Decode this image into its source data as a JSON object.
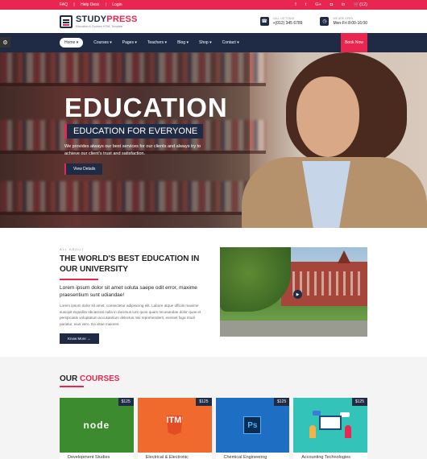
{
  "topbar": {
    "links": [
      "FAQ",
      "Help Desk",
      "Login"
    ],
    "social_icons": [
      "facebook-icon",
      "twitter-icon",
      "google-plus-icon",
      "instagram-icon",
      "linkedin-icon"
    ],
    "social_glyphs": [
      "f",
      "t",
      "G+",
      "◘",
      "in"
    ],
    "cart": "(12)"
  },
  "header": {
    "brand_part1": "STUDY",
    "brand_part2": "PRESS",
    "tagline": "Education & Courses HTML Template",
    "call_label": "CALL US TODAY",
    "call_value": "+(012) 345 6789",
    "open_label": "WE ARE OPEN",
    "open_value": "Mon-Fri 8:00-16:00"
  },
  "nav": {
    "items": [
      "Home",
      "Courses",
      "Pages",
      "Teachers",
      "Blog",
      "Shop",
      "Contact"
    ],
    "book_now": "Book Now"
  },
  "hero": {
    "title": "EDUCATION",
    "subtitle": "EDUCATION FOR EVERYONE",
    "description": "We provides always our best services for our clients and always try to achieve our client's trust and satisfaction.",
    "button": "View Details"
  },
  "about": {
    "label": "ALL ABOUT",
    "title": "THE WORLD'S BEST EDUCATION IN OUR UNIVERSITY",
    "lead": "Lorem ipsum dolor sit amet soluta saepe odit error, maxime praesentium sunt udiandae!",
    "body": "Lorem ipsum dolor sit amet, consectetur adipisicing elit. Labore atque officiis maxime suscipit expedita obcaecati nulla in ducimus iure quos quam recusandae dolor quas et perspiciatis voluptatum accusantium delectus nisi reprehenderit, eveniet fuga modi pariatur, eius vero. Ea vitae maiores.",
    "button": "Know More →"
  },
  "courses": {
    "title_part1": "OUR",
    "title_part2": "COURSES",
    "items": [
      {
        "name": "Development Studies",
        "price": "$125",
        "logo": "node"
      },
      {
        "name": "Electrical & Electronic",
        "price": "$125",
        "logo": "HTML 5"
      },
      {
        "name": "Chemical Engineering",
        "price": "$125",
        "logo": "Ps"
      },
      {
        "name": "Accounting Technologies",
        "price": "$125",
        "logo": ""
      }
    ]
  },
  "colors": {
    "accent": "#e8264f",
    "navy": "#1f2a44"
  }
}
